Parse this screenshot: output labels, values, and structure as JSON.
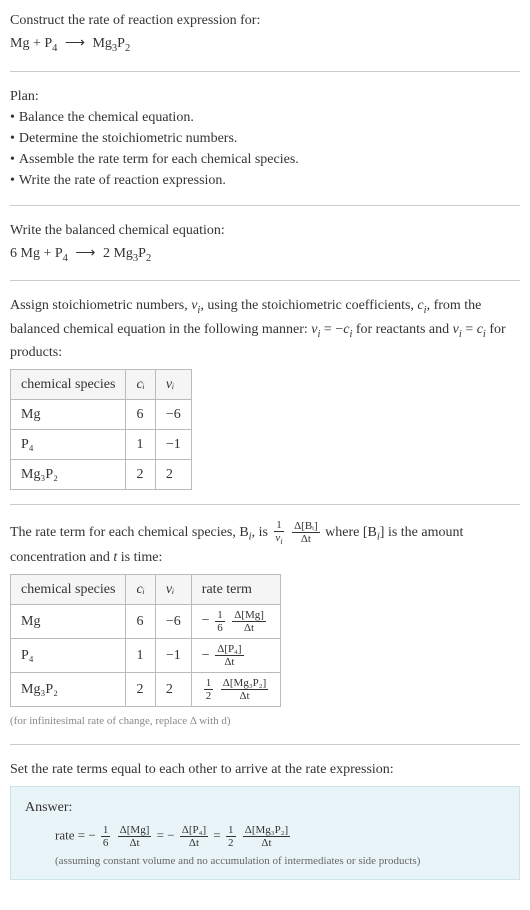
{
  "intro": {
    "title": "Construct the rate of reaction expression for:",
    "equation_lhs": "Mg + P",
    "equation_lhs_sub": "4",
    "equation_rhs": "Mg",
    "equation_rhs_sub1": "3",
    "equation_rhs_mid": "P",
    "equation_rhs_sub2": "2"
  },
  "plan": {
    "heading": "Plan:",
    "items": [
      "Balance the chemical equation.",
      "Determine the stoichiometric numbers.",
      "Assemble the rate term for each chemical species.",
      "Write the rate of reaction expression."
    ]
  },
  "balanced": {
    "heading": "Write the balanced chemical equation:",
    "lhs1_coef": "6",
    "lhs1": "Mg + P",
    "lhs1_sub": "4",
    "rhs_coef": "2",
    "rhs": "Mg",
    "rhs_sub1": "3",
    "rhs_mid": "P",
    "rhs_sub2": "2"
  },
  "assign": {
    "text1": "Assign stoichiometric numbers, ",
    "nu": "ν",
    "sub_i": "i",
    "text2": ", using the stoichiometric coefficients, ",
    "c": "c",
    "text3": ", from the balanced chemical equation in the following manner: ",
    "eq1_lhs": "ν",
    "eq1_rhs_pre": " = −",
    "eq1_rhs": "c",
    "text4": " for reactants and ",
    "eq2_lhs": "ν",
    "eq2_rhs_pre": " = ",
    "eq2_rhs": "c",
    "text5": " for products:"
  },
  "table1": {
    "headers": {
      "h1": "chemical species",
      "h2": "cᵢ",
      "h3": "νᵢ"
    },
    "rows": [
      {
        "species": "Mg",
        "c": "6",
        "nu": "−6"
      },
      {
        "species": "P₄",
        "c": "1",
        "nu": "−1"
      },
      {
        "species": "Mg₃P₂",
        "c": "2",
        "nu": "2"
      }
    ]
  },
  "rateterm": {
    "pre": "The rate term for each chemical species, B",
    "sub_i": "i",
    "mid": ", is ",
    "frac1_num": "1",
    "frac1_den_pre": "ν",
    "frac1_den_sub": "i",
    "frac2_num": "Δ[Bᵢ]",
    "frac2_den": "Δt",
    "post": " where [B",
    "post2": "] is the amount concentration and ",
    "t": "t",
    "post3": " is time:"
  },
  "table2": {
    "headers": {
      "h1": "chemical species",
      "h2": "cᵢ",
      "h3": "νᵢ",
      "h4": "rate term"
    },
    "rows": [
      {
        "species": "Mg",
        "c": "6",
        "nu": "−6",
        "sign": "−",
        "f1n": "1",
        "f1d": "6",
        "f2n": "Δ[Mg]",
        "f2d": "Δt"
      },
      {
        "species": "P₄",
        "c": "1",
        "nu": "−1",
        "sign": "−",
        "f1n": "",
        "f1d": "",
        "f2n": "Δ[P₄]",
        "f2d": "Δt"
      },
      {
        "species": "Mg₃P₂",
        "c": "2",
        "nu": "2",
        "sign": "",
        "f1n": "1",
        "f1d": "2",
        "f2n": "Δ[Mg₃P₂]",
        "f2d": "Δt"
      }
    ],
    "note": "(for infinitesimal rate of change, replace Δ with d)"
  },
  "final": {
    "heading": "Set the rate terms equal to each other to arrive at the rate expression:",
    "answer_label": "Answer:",
    "rate_word": "rate",
    "eq": " = ",
    "neg": "−",
    "t1_f1n": "1",
    "t1_f1d": "6",
    "t1_f2n": "Δ[Mg]",
    "t1_f2d": "Δt",
    "t2_f2n": "Δ[P₄]",
    "t2_f2d": "Δt",
    "t3_f1n": "1",
    "t3_f1d": "2",
    "t3_f2n": "Δ[Mg₃P₂]",
    "t3_f2d": "Δt",
    "note": "(assuming constant volume and no accumulation of intermediates or side products)"
  }
}
